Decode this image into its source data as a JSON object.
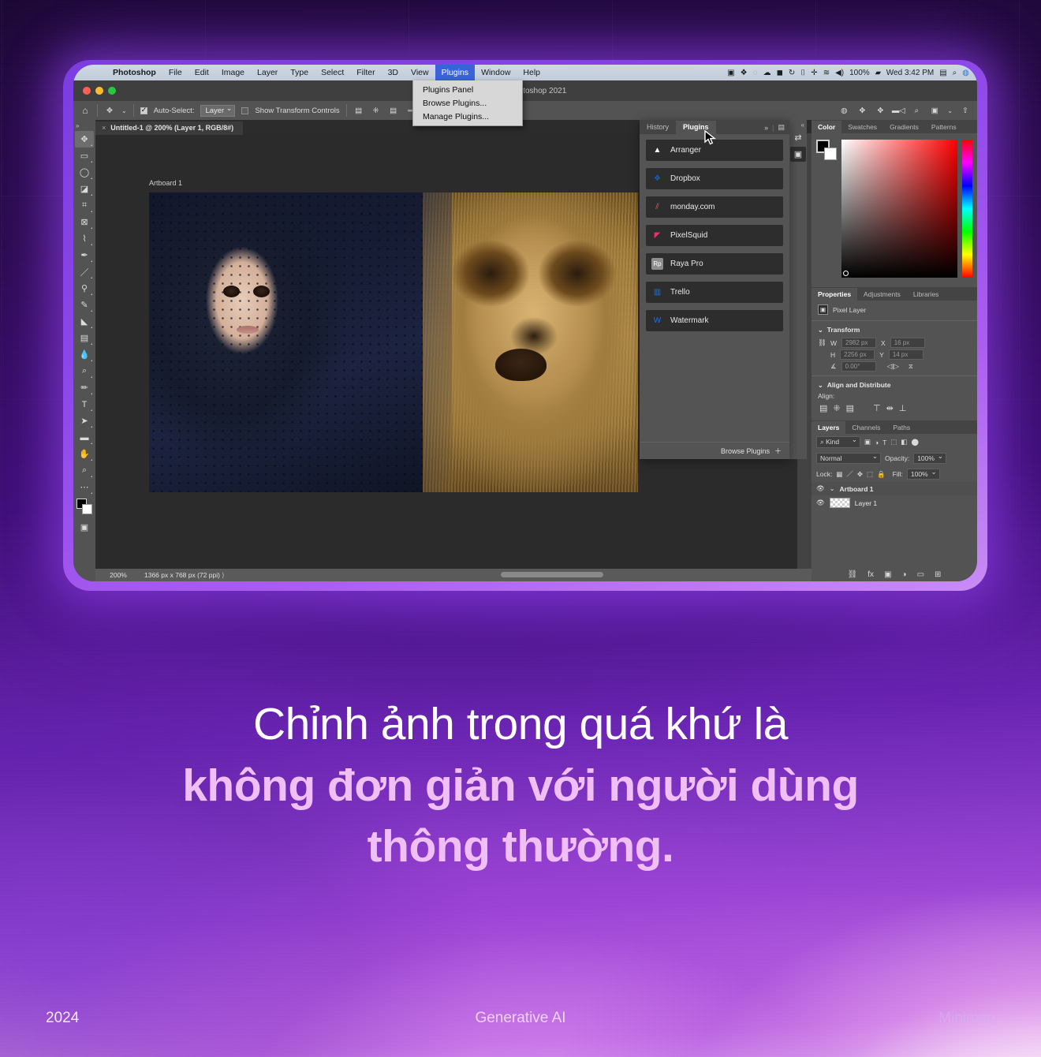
{
  "macbar": {
    "menus": [
      {
        "label": "Photoshop",
        "app": true,
        "active": false
      },
      {
        "label": "File",
        "active": false
      },
      {
        "label": "Edit",
        "active": false
      },
      {
        "label": "Image",
        "active": false
      },
      {
        "label": "Layer",
        "active": false
      },
      {
        "label": "Type",
        "active": false
      },
      {
        "label": "Select",
        "active": false
      },
      {
        "label": "Filter",
        "active": false
      },
      {
        "label": "3D",
        "active": false
      },
      {
        "label": "View",
        "active": false
      },
      {
        "label": "Plugins",
        "active": true
      },
      {
        "label": "Window",
        "active": false
      },
      {
        "label": "Help",
        "active": false
      }
    ],
    "status": {
      "battery_percent": "100%",
      "clock": "Wed 3:42 PM",
      "icons": [
        "screen-recording-icon",
        "dropbox-icon",
        "creative-cloud-icon",
        "onedrive-icon",
        "video-icon",
        "backup-icon",
        "airplay-icon",
        "bluetooth-icon",
        "wifi-icon",
        "volume-icon",
        "battery-icon",
        "flag-icon",
        "spotlight-search-icon",
        "siri-icon"
      ]
    }
  },
  "plugins_menu": {
    "items": [
      "Plugins Panel",
      "Browse Plugins...",
      "Manage Plugins..."
    ]
  },
  "window": {
    "title": "Adobe Photoshop 2021",
    "traffic_colors": [
      "#ff5f57",
      "#febc2e",
      "#28c840"
    ]
  },
  "options_bar": {
    "home_icon": "home-icon",
    "tool_icon": "move-tool-icon",
    "auto_select_label": "Auto-Select:",
    "auto_select_checked": true,
    "auto_select_value": "Layer",
    "show_transform_label": "Show Transform Controls",
    "show_transform_checked": false,
    "align_icons": [
      "align-left-icon",
      "align-center-h-icon",
      "align-right-icon",
      "align-middle-icon",
      "align-top-icon",
      "distribute-h-icon",
      "distribute-v-icon"
    ],
    "right_icons": [
      "3d-mode-icon",
      "3d-orbit-icon",
      "3d-camera-icon",
      "search-icon",
      "workspace-icon",
      "share-icon"
    ]
  },
  "document_tab": {
    "close_icon": "close-icon",
    "title": "Untitled-1 @ 200% (Layer 1, RGB/8#)"
  },
  "tools": [
    {
      "name": "move-tool",
      "glyph": "✥",
      "selected": true
    },
    {
      "name": "marquee-tool",
      "glyph": "▭",
      "selected": false
    },
    {
      "name": "lasso-tool",
      "glyph": "◯",
      "selected": false
    },
    {
      "name": "object-selection-tool",
      "glyph": "◪",
      "selected": false
    },
    {
      "name": "crop-tool",
      "glyph": "⌗",
      "selected": false
    },
    {
      "name": "frame-tool",
      "glyph": "⊠",
      "selected": false
    },
    {
      "name": "eyedropper-tool",
      "glyph": "⌇",
      "selected": false
    },
    {
      "name": "healing-brush-tool",
      "glyph": "✒",
      "selected": false
    },
    {
      "name": "brush-tool",
      "glyph": "／",
      "selected": false
    },
    {
      "name": "clone-stamp-tool",
      "glyph": "⚲",
      "selected": false
    },
    {
      "name": "history-brush-tool",
      "glyph": "✎",
      "selected": false
    },
    {
      "name": "eraser-tool",
      "glyph": "◣",
      "selected": false
    },
    {
      "name": "gradient-tool",
      "glyph": "▤",
      "selected": false
    },
    {
      "name": "blur-tool",
      "glyph": "💧",
      "selected": false
    },
    {
      "name": "dodge-tool",
      "glyph": "⌕",
      "selected": false
    },
    {
      "name": "pen-tool",
      "glyph": "✏",
      "selected": false
    },
    {
      "name": "type-tool",
      "glyph": "T",
      "selected": false
    },
    {
      "name": "path-selection-tool",
      "glyph": "➤",
      "selected": false
    },
    {
      "name": "rectangle-tool",
      "glyph": "▬",
      "selected": false
    },
    {
      "name": "hand-tool",
      "glyph": "✋",
      "selected": false
    },
    {
      "name": "zoom-tool",
      "glyph": "⌕",
      "selected": false
    },
    {
      "name": "edit-toolbar-tool",
      "glyph": "⋯",
      "selected": false
    }
  ],
  "canvas": {
    "artboard_label": "Artboard 1",
    "artwork_description": "Photo composite of a woman in a dark blue dotted veil beside a lion's face"
  },
  "status_bar": {
    "zoom": "200%",
    "doc_size": "1366 px x 768 px (72 ppi)"
  },
  "plugins_panel": {
    "tabs": [
      {
        "label": "History",
        "active": false
      },
      {
        "label": "Plugins",
        "active": true
      }
    ],
    "tab_right_icons": [
      "expand-icon",
      "panel-menu-icon"
    ],
    "items": [
      {
        "label": "Arranger",
        "icon": "arranger-icon",
        "color": "#ffffff",
        "bg": "#1d1d1d",
        "glyph": "▲"
      },
      {
        "label": "Dropbox",
        "icon": "dropbox-icon",
        "color": "#0061ff",
        "bg": "#1d1d1d",
        "glyph": "❖"
      },
      {
        "label": "monday.com",
        "icon": "monday-icon",
        "color": "#f95d5d",
        "bg": "#1d1d1d",
        "glyph": "⫽"
      },
      {
        "label": "PixelSquid",
        "icon": "pixelsquid-icon",
        "color": "#ef2f6b",
        "bg": "#1d1d1d",
        "glyph": "◤"
      },
      {
        "label": "Raya Pro",
        "icon": "raya-pro-icon",
        "color": "#cfcfcf",
        "bg": "#8d8d8d",
        "glyph": "Rp"
      },
      {
        "label": "Trello",
        "icon": "trello-icon",
        "color": "#1b74e4",
        "bg": "#1d1d1d",
        "glyph": "▥"
      },
      {
        "label": "Watermark",
        "icon": "watermark-icon",
        "color": "#1b74e4",
        "bg": "#1d1d1d",
        "glyph": "W"
      }
    ],
    "footer_label": "Browse Plugins",
    "footer_icon": "plus-icon"
  },
  "panel_dock": {
    "collapse_icon": "collapse-icon",
    "buttons": [
      "history-actions-icon",
      "libraries-icon"
    ]
  },
  "color_panel": {
    "tabs": [
      {
        "label": "Color",
        "active": true
      },
      {
        "label": "Swatches",
        "active": false
      },
      {
        "label": "Gradients",
        "active": false
      },
      {
        "label": "Patterns",
        "active": false
      }
    ],
    "foreground": "#000000",
    "background": "#ffffff"
  },
  "properties_panel": {
    "tabs": [
      {
        "label": "Properties",
        "active": true
      },
      {
        "label": "Adjustments",
        "active": false
      },
      {
        "label": "Libraries",
        "active": false
      }
    ],
    "layer_type": "Pixel Layer",
    "layer_type_icon": "image-icon",
    "transform_title": "Transform",
    "fields": [
      {
        "label": "W",
        "value": "2982 px"
      },
      {
        "label": "X",
        "value": "16 px"
      },
      {
        "label": "H",
        "value": "2256 px"
      },
      {
        "label": "Y",
        "value": "14 px"
      }
    ],
    "angle_label": "angle-icon",
    "angle_value": "0.00°",
    "align_title": "Align and Distribute",
    "align_label": "Align:",
    "align_icons": [
      "align-left-icon",
      "align-center-h-icon",
      "align-right-icon",
      "align-top-icon",
      "align-middle-v-icon",
      "align-bottom-icon"
    ]
  },
  "layers_panel": {
    "tabs": [
      {
        "label": "Layers",
        "active": true
      },
      {
        "label": "Channels",
        "active": false
      },
      {
        "label": "Paths",
        "active": false
      }
    ],
    "filter_label": "Kind",
    "filter_icons": [
      "image-filter-icon",
      "adjustment-filter-icon",
      "type-filter-icon",
      "shape-filter-icon",
      "smart-object-filter-icon",
      "toggle-filter-icon"
    ],
    "blend_mode": "Normal",
    "opacity_label": "Opacity:",
    "opacity_value": "100%",
    "lock_label": "Lock:",
    "lock_icons": [
      "lock-transparency-icon",
      "lock-image-icon",
      "lock-position-icon",
      "lock-artboard-icon",
      "lock-all-icon"
    ],
    "fill_label": "Fill:",
    "fill_value": "100%",
    "rows": [
      {
        "name": "Artboard 1",
        "type": "group",
        "visible": true,
        "eye_icon": "eye-icon",
        "chevron_icon": "chevron-down-icon"
      },
      {
        "name": "Layer 1",
        "type": "layer",
        "visible": true,
        "eye_icon": "eye-icon"
      }
    ],
    "bottom_icons": [
      "link-icon",
      "fx-icon",
      "mask-icon",
      "adjustment-icon",
      "folder-icon",
      "new-layer-icon"
    ]
  },
  "cursor": {
    "icon": "mouse-pointer-icon"
  },
  "caption": {
    "line1": "Chỉnh ảnh trong quá khứ là",
    "line2": "không đơn giản với người dùng",
    "line3": "thông thường."
  },
  "footer": {
    "year": "2024",
    "center": "Generative AI",
    "brand": "Minimag"
  },
  "colors": {
    "accent_purple": "#8a46e8",
    "caption_highlight": "#f0bff5",
    "menu_active": "#3b63d8"
  }
}
